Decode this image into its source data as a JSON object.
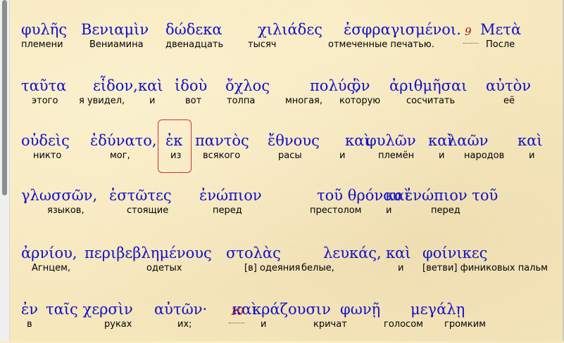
{
  "lines": [
    {
      "words": [
        {
          "greek": "φυλῆς",
          "rus": "племени"
        },
        {
          "greek": "Βενιαμὶν",
          "rus": "Вениамина"
        },
        {
          "greek": "δώδεκα",
          "rus": "двенадцать"
        },
        {
          "greek": "χιλιάδες",
          "rus": "тысяч"
        },
        {
          "greek": "ἐσφραγισμένοι.",
          "rus": "отмеченные печатью."
        },
        {
          "greek": "Μετὰ",
          "rus": "После"
        }
      ],
      "verse_number": "9"
    },
    {
      "words": [
        {
          "greek": "ταῦτα",
          "rus": "этого"
        },
        {
          "greek": "εἶδον,",
          "rus": "я увидел,"
        },
        {
          "greek": "καὶ",
          "rus": "и"
        },
        {
          "greek": "ἰδοὺ",
          "rus": "вот"
        },
        {
          "greek": "ὄχλος",
          "rus": "толпа"
        },
        {
          "greek": "πολύς,",
          "rus": "многая,"
        },
        {
          "greek": "ὃν",
          "rus": "которую"
        },
        {
          "greek": "ἀριθμῆσαι",
          "rus": "сосчитать"
        },
        {
          "greek": "αὐτὸν",
          "rus": "её"
        }
      ]
    },
    {
      "words": [
        {
          "greek": "οὐδεὶς",
          "rus": "никто"
        },
        {
          "greek": "ἐδύνατο,",
          "rus": "мог,"
        },
        {
          "greek": "ἐκ",
          "rus": "из"
        },
        {
          "greek": "παντὸς",
          "rus": "всякого"
        },
        {
          "greek": "ἔθνους",
          "rus": "расы"
        },
        {
          "greek": "καὶ",
          "rus": "и"
        },
        {
          "greek": "φυλῶν",
          "rus": "племён"
        },
        {
          "greek": "καὶ",
          "rus": "и"
        },
        {
          "greek": "λαῶν",
          "rus": "народов"
        },
        {
          "greek": "καὶ",
          "rus": "и"
        }
      ]
    },
    {
      "words": [
        {
          "greek": "γλωσσῶν,",
          "rus": "языков,"
        },
        {
          "greek": "ἑστῶτες",
          "rus": "стоящие"
        },
        {
          "greek": "ἐνώπιον",
          "rus": "перед"
        },
        {
          "greek": "τοῦ θρόνου",
          "rus": "престолом"
        },
        {
          "greek": "καὶ",
          "rus": "и"
        },
        {
          "greek": "ἐνώπιον τοῦ",
          "rus": "перед"
        }
      ]
    },
    {
      "words": [
        {
          "greek": "ἀρνίου,",
          "rus": "Агнцем,"
        },
        {
          "greek": "περιβεβλημένους",
          "rus": "одетых"
        },
        {
          "greek": "στολὰς",
          "rus": "[в] одеяния"
        },
        {
          "greek": "λευκάς,",
          "rus": "белые,"
        },
        {
          "greek": "καὶ",
          "rus": "и"
        },
        {
          "greek": "φοίνικες",
          "rus": "[ветви] финиковых пальм"
        }
      ]
    },
    {
      "words": [
        {
          "greek": "ἐν",
          "rus": "в"
        },
        {
          "greek": "ταῖς χερσὶν",
          "rus": "руках"
        },
        {
          "greek": "αὐτῶν·",
          "rus": "их;"
        },
        {
          "greek": "καὶ",
          "rus": "и"
        },
        {
          "greek": "κράζουσιν",
          "rus": "кричат"
        },
        {
          "greek": "φωνῇ",
          "rus": "голосом"
        },
        {
          "greek": "μεγάλῃ",
          "rus": "громким"
        }
      ],
      "verse_number": "10"
    }
  ]
}
